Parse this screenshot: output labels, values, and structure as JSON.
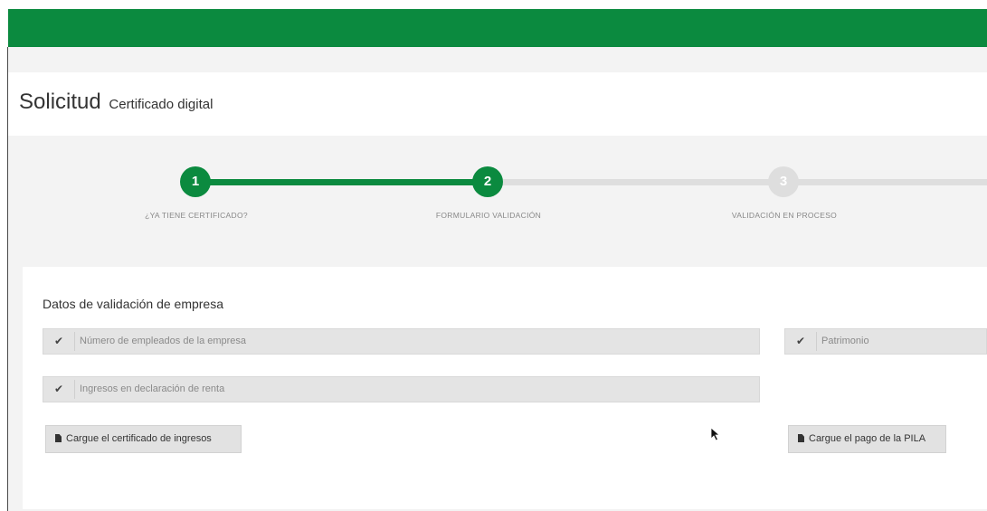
{
  "header": {
    "title": "Solicitud",
    "subtitle": "Certificado digital"
  },
  "stepper": {
    "steps": [
      {
        "number": "1",
        "label": "¿YA TIENE CERTIFICADO?",
        "state": "complete"
      },
      {
        "number": "2",
        "label": "FORMULARIO VALIDACIÓN",
        "state": "active"
      },
      {
        "number": "3",
        "label": "VALIDACIÓN EN PROCESO",
        "state": "pending"
      }
    ],
    "colors": {
      "active": "#0b8a3f",
      "pending": "#dedede"
    }
  },
  "form": {
    "section_title": "Datos de validación de empresa",
    "fields": {
      "employees": {
        "placeholder": "Número de empleados de la empresa",
        "icon": "check-icon"
      },
      "patrimonio": {
        "placeholder": "Patrimonio",
        "icon": "check-icon"
      },
      "ingresos": {
        "placeholder": "Ingresos en declaración de renta",
        "icon": "check-icon"
      }
    },
    "buttons": {
      "upload_income": {
        "label": "Cargue el certificado de ingresos",
        "icon": "file-icon"
      },
      "upload_pila": {
        "label": "Cargue el pago de la PILA",
        "icon": "file-icon"
      }
    }
  },
  "theme": {
    "brand_green": "#0b8a3f"
  }
}
